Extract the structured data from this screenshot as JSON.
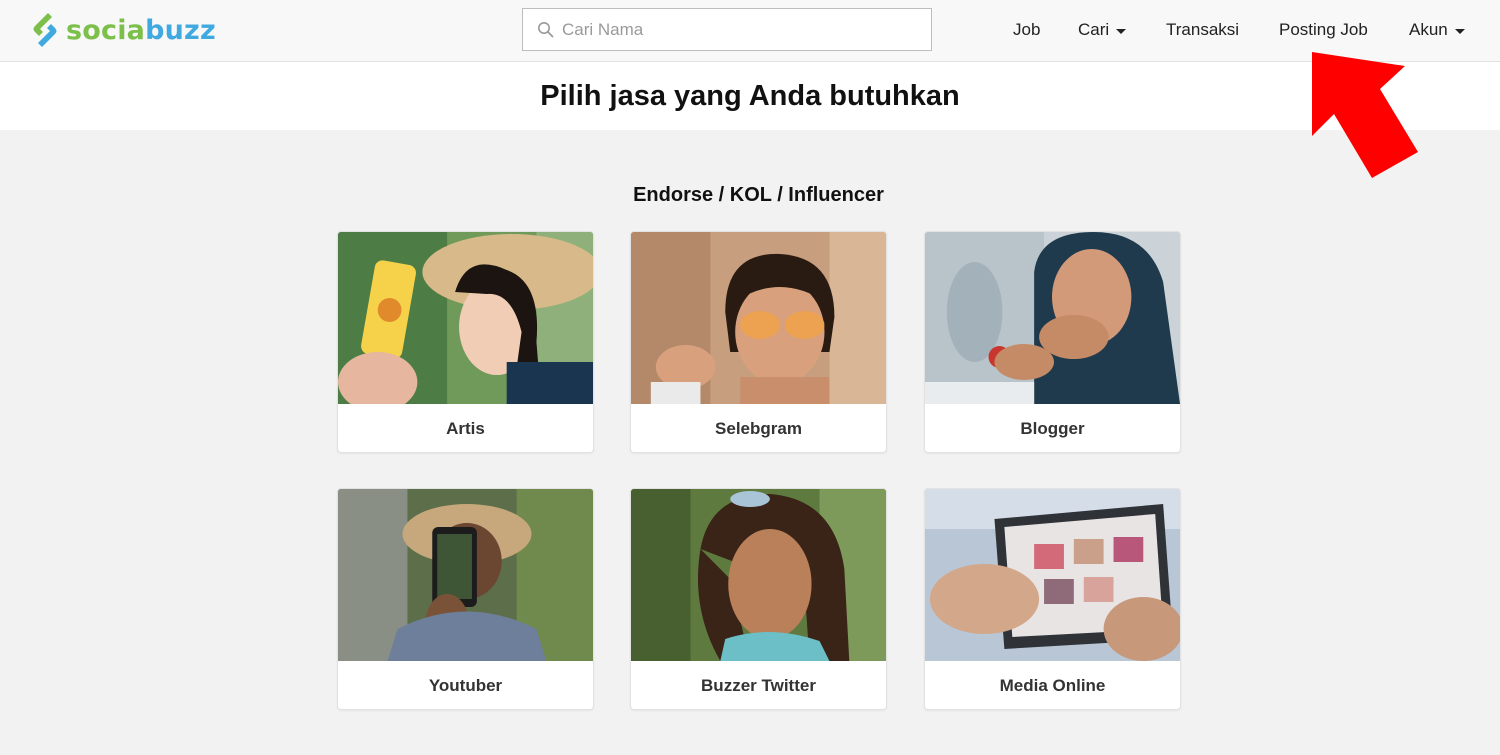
{
  "brand": {
    "part1": "socia",
    "part2": "buzz",
    "colors": {
      "green": "#7cc04b",
      "blue": "#3fa9e0"
    }
  },
  "search": {
    "placeholder": "Cari Nama",
    "value": ""
  },
  "nav": {
    "job": "Job",
    "cari": "Cari",
    "transaksi": "Transaksi",
    "posting_job": "Posting Job",
    "akun": "Akun"
  },
  "page_title": "Pilih jasa yang Anda butuhkan",
  "section_title": "Endorse / KOL / Influencer",
  "cards": [
    {
      "label": "Artis"
    },
    {
      "label": "Selebgram"
    },
    {
      "label": "Blogger"
    },
    {
      "label": "Youtuber"
    },
    {
      "label": "Buzzer Twitter"
    },
    {
      "label": "Media Online"
    }
  ],
  "annotation": {
    "arrow_color": "#ff0000",
    "icon": "red-arrow-icon"
  }
}
